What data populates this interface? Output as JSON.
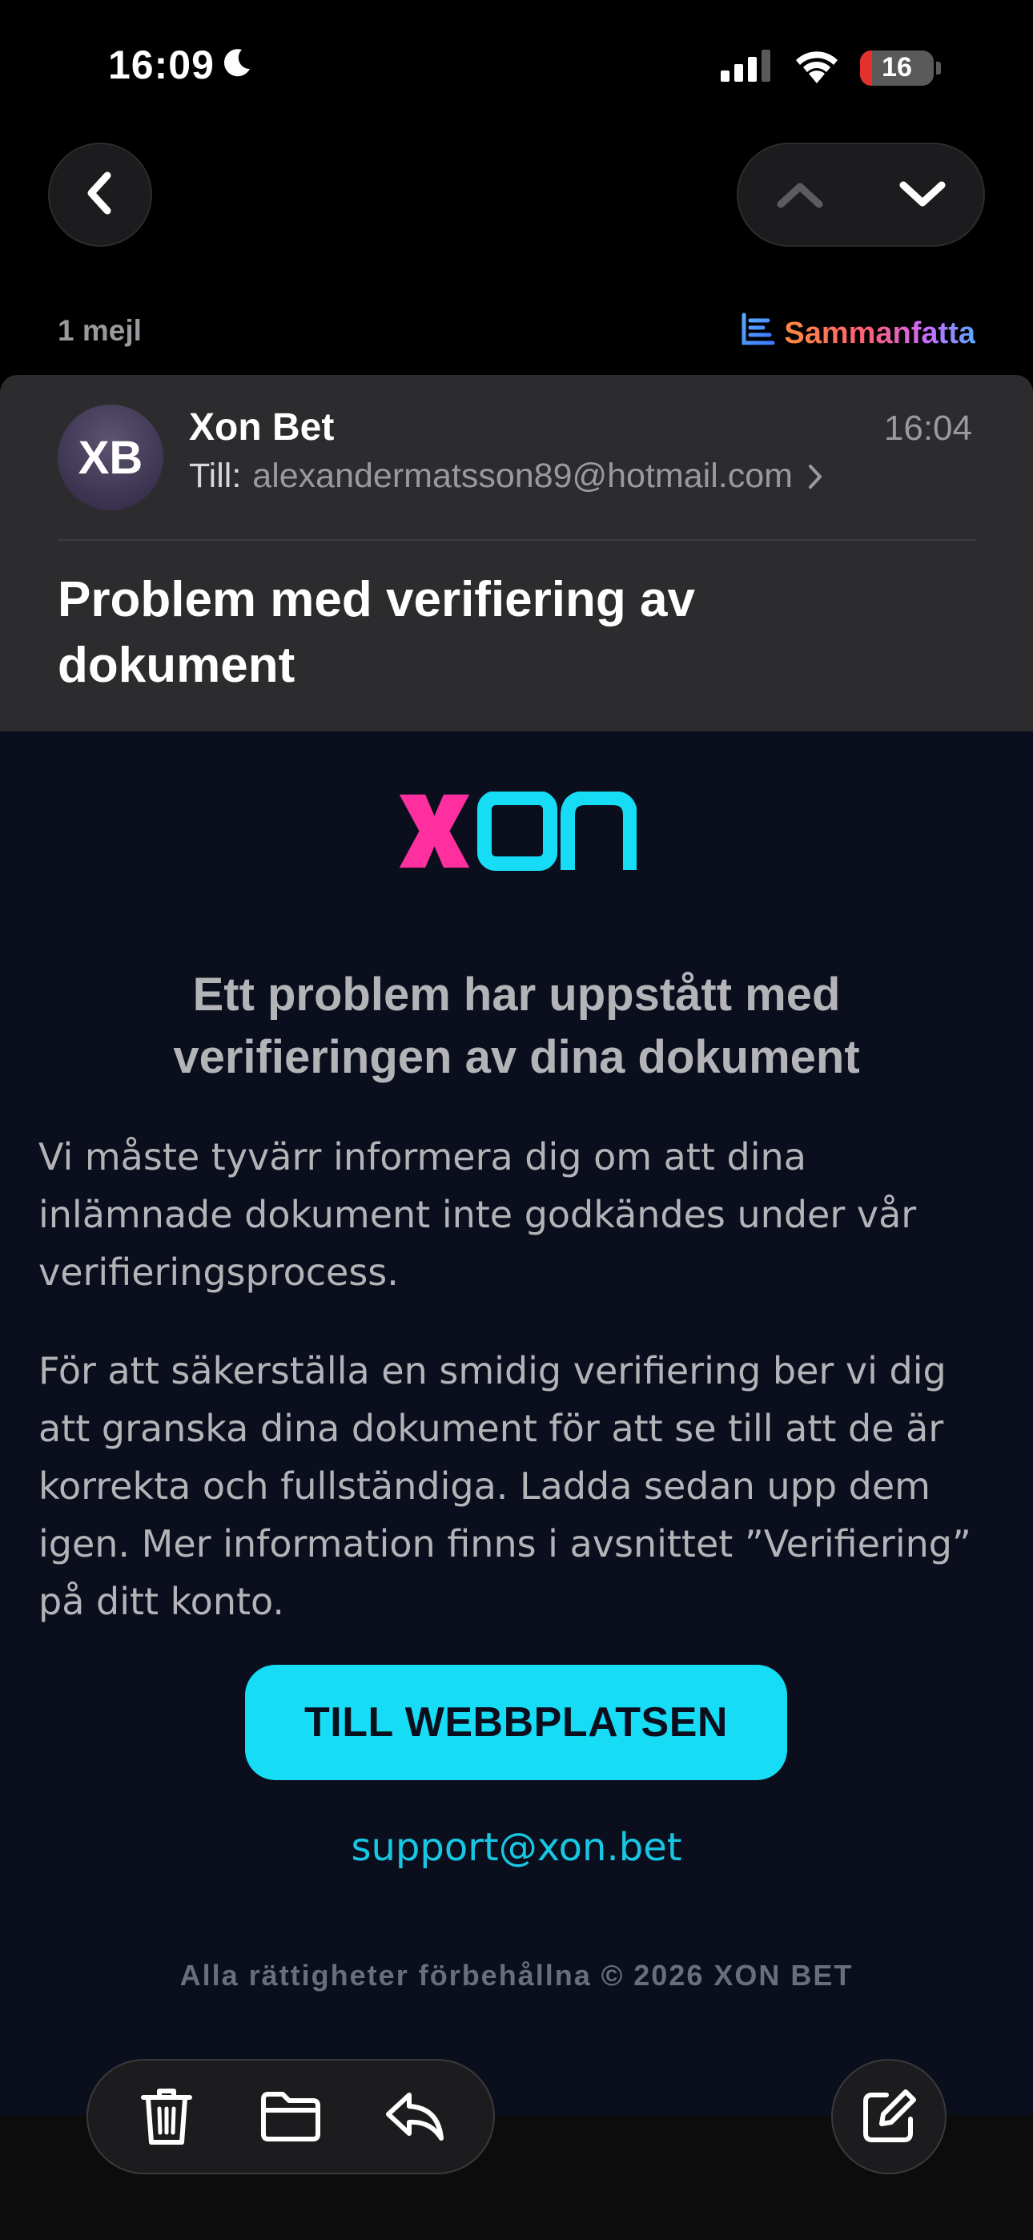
{
  "status_bar": {
    "time": "16:09",
    "battery_level": "16",
    "icons": [
      "moon-icon",
      "cellular-signal-icon",
      "wifi-icon",
      "battery-icon"
    ]
  },
  "navigation": {
    "back_icon": "chevron-left-icon",
    "prev_icon": "chevron-up-icon",
    "next_icon": "chevron-down-icon"
  },
  "thread": {
    "count_label": "1 mejl",
    "summarize_label": "Sammanfatta",
    "summarize_icon": "summarize-icon"
  },
  "message": {
    "avatar_initials": "XB",
    "sender": "Xon Bet",
    "time": "16:04",
    "recipient_prefix": "Till:",
    "recipient": "alexandermatsson89@hotmail.com",
    "subject": "Problem med verifiering av dokument"
  },
  "email_content": {
    "brand": "xon",
    "heading": "Ett problem har uppstått med verifieringen av dina dokument",
    "paragraph_1": "Vi måste tyvärr informera dig om att dina inlämnade dokument inte godkändes under vår verifieringsprocess.",
    "paragraph_2": "För att säkerställa en smidig verifiering ber vi dig att granska dina dokument för att se till att de är korrekta och fullständiga. Ladda sedan upp dem igen. Mer information finns i avsnittet ”Verifiering” på ditt konto.",
    "cta_label": "TILL WEBBPLATSEN",
    "support_email": "support@xon.bet",
    "copyright": "Alla rättigheter förbehållna © 2026 XON BET"
  },
  "toolbar": {
    "icons": [
      "trash-icon",
      "folder-icon",
      "reply-icon",
      "compose-icon"
    ]
  },
  "colors": {
    "accent_cyan": "#17dcf6",
    "brand_pink": "#ff2fa0",
    "body_background": "#0b0f1d",
    "header_background": "#2c2c2e"
  }
}
